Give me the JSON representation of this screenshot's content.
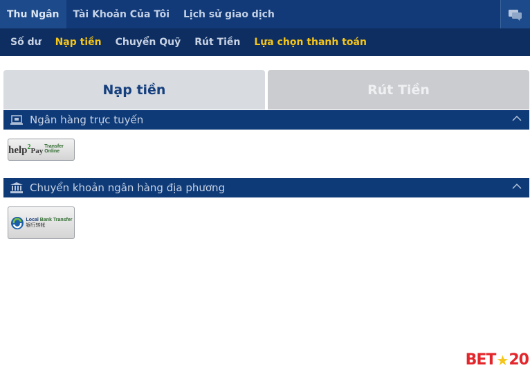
{
  "top_tabs": [
    "Thu Ngân",
    "Tài Khoản Của Tôi",
    "Lịch sử giao dịch"
  ],
  "sub_tabs": [
    "Số dư",
    "Nạp tiền",
    "Chuyển Quỹ",
    "Rút Tiền",
    "Lựa chọn thanh toán"
  ],
  "main_tabs": {
    "deposit": "Nạp tiền",
    "withdraw": "Rút Tiền"
  },
  "sections": {
    "online": {
      "title": "Ngân hàng trực tuyến",
      "method": {
        "name": "help2pay",
        "logo_main": "help",
        "logo_sup": "2",
        "logo_sub": "Pay",
        "logo_text": "Transfer Online"
      }
    },
    "local": {
      "title": "Chuyển khoản ngân hàng địa phương",
      "method": {
        "line1a": "Local",
        "line1b": "Bank Transfer",
        "line2": "银行转帐"
      }
    }
  },
  "brand": {
    "bet": "BET",
    "num": "20"
  },
  "colors": {
    "header": "#123a78",
    "subheader": "#0e2e61",
    "accent": "#f5c518",
    "brand": "#e3262b"
  },
  "icons": [
    "chat-icon",
    "online-bank-icon",
    "bank-icon",
    "chevron-up-icon"
  ]
}
